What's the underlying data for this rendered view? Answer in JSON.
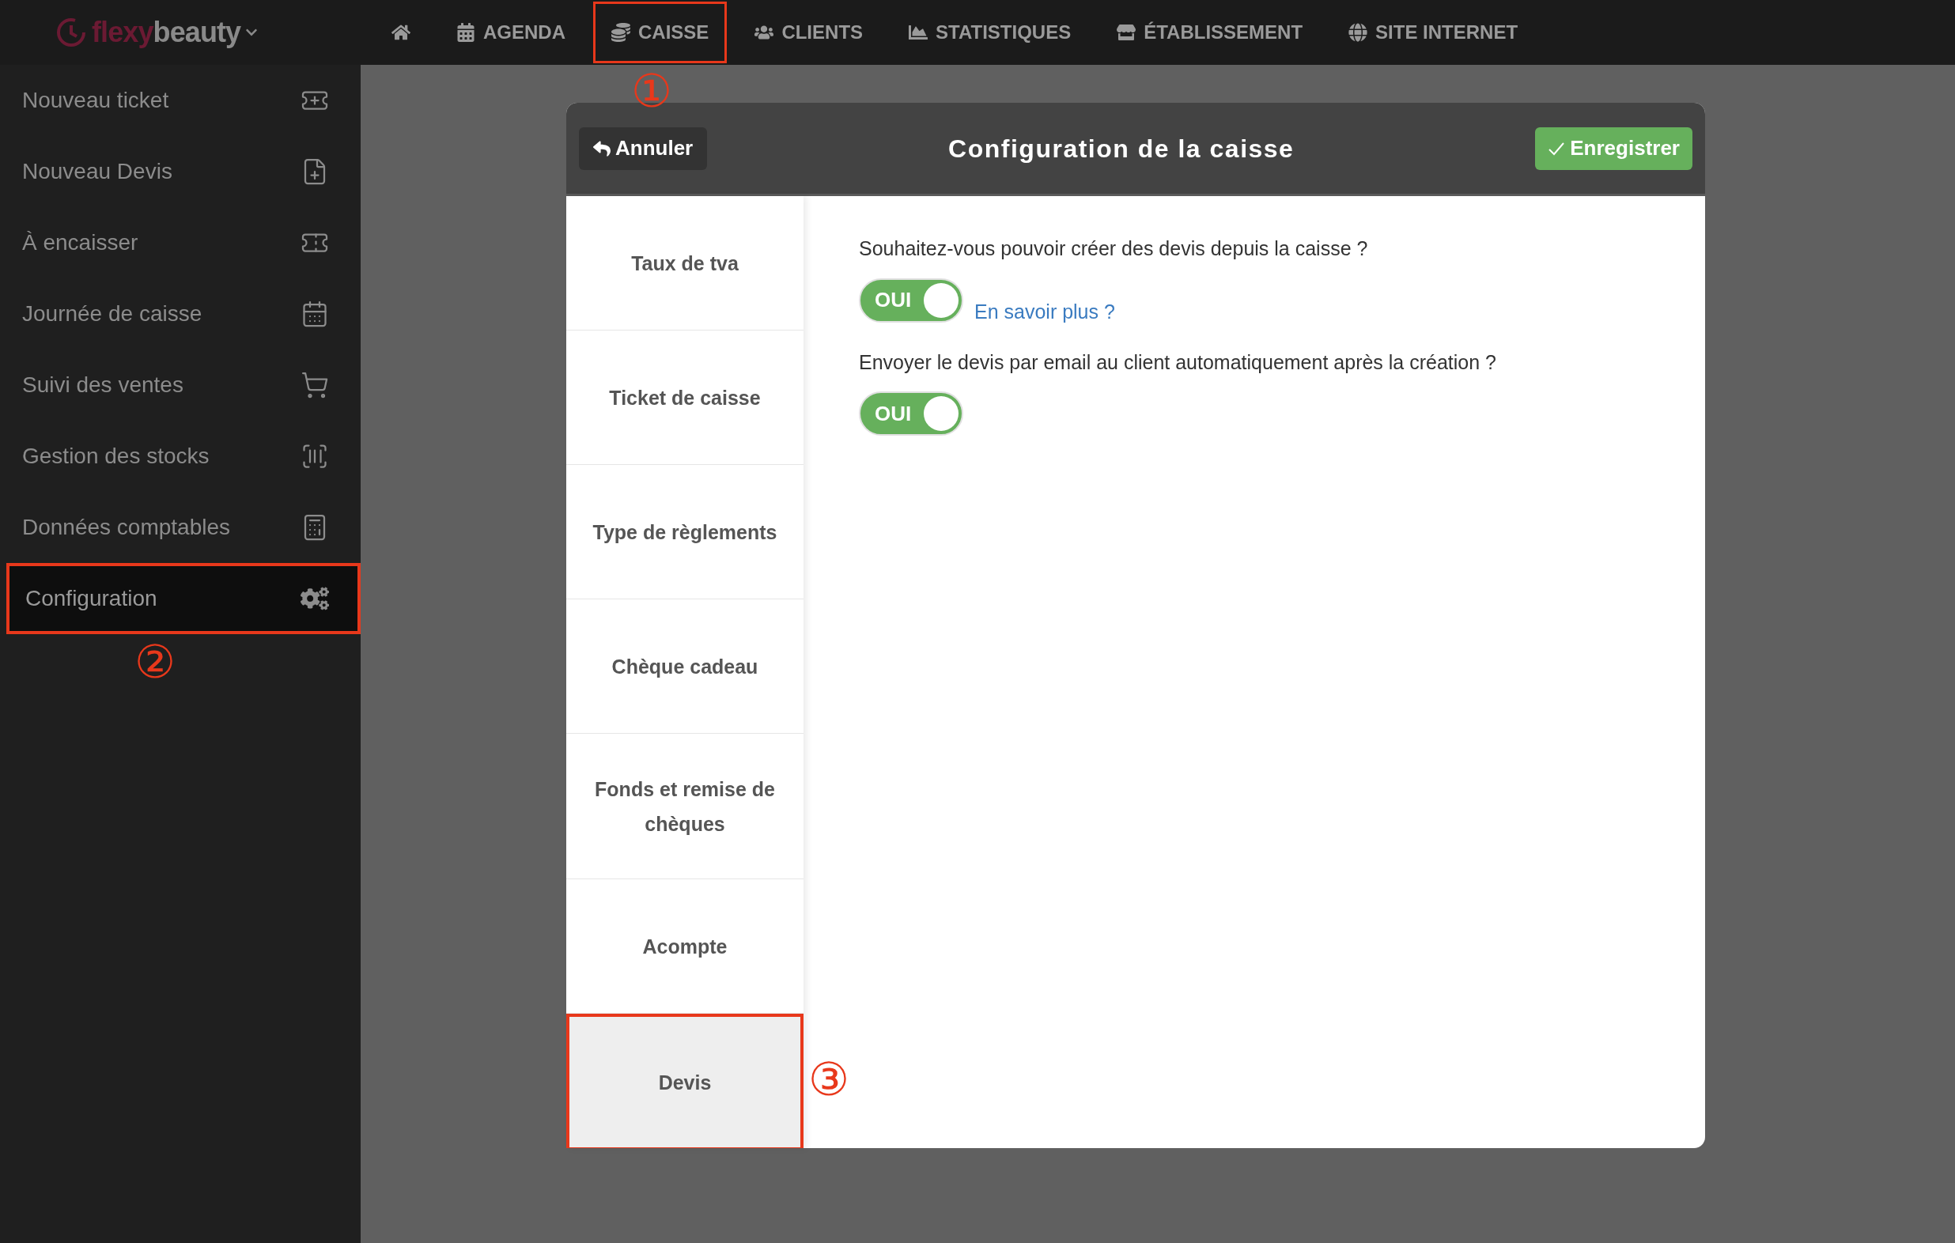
{
  "logo": {
    "first": "flexy",
    "second": "beauty"
  },
  "nav": [
    {
      "highlighted": false
    },
    {
      "label": "AGENDA",
      "highlighted": false
    },
    {
      "label": "CAISSE",
      "highlighted": true,
      "callout": "①"
    },
    {
      "label": "CLIENTS",
      "highlighted": false
    },
    {
      "label": "STATISTIQUES",
      "highlighted": false
    },
    {
      "label": "ÉTABLISSEMENT",
      "highlighted": false
    },
    {
      "label": "SITE INTERNET",
      "highlighted": false
    }
  ],
  "sidebar": {
    "items": [
      {
        "label": "Nouveau ticket",
        "selected": false,
        "highlighted": false
      },
      {
        "label": "Nouveau Devis",
        "selected": false,
        "highlighted": false
      },
      {
        "label": "À encaisser",
        "selected": false,
        "highlighted": false
      },
      {
        "label": "Journée de caisse",
        "selected": false,
        "highlighted": false
      },
      {
        "label": "Suivi des ventes",
        "selected": false,
        "highlighted": false
      },
      {
        "label": "Gestion des stocks",
        "selected": false,
        "highlighted": false
      },
      {
        "label": "Données comptables",
        "selected": false,
        "highlighted": false
      },
      {
        "label": "Configuration",
        "selected": true,
        "highlighted": true,
        "callout": "②"
      }
    ]
  },
  "dialog": {
    "cancel": "Annuler",
    "title": "Configuration de la caisse",
    "save": "Enregistrer",
    "tabs": [
      {
        "label": "Taux de tva",
        "selected": false,
        "highlighted": false
      },
      {
        "label": "Ticket de caisse",
        "selected": false,
        "highlighted": false
      },
      {
        "label": "Type de règlements",
        "selected": false,
        "highlighted": false
      },
      {
        "label": "Chèque cadeau",
        "selected": false,
        "highlighted": false
      },
      {
        "label": "Fonds et remise de chèques",
        "selected": false,
        "highlighted": false
      },
      {
        "label": "Acompte",
        "selected": false,
        "highlighted": false
      },
      {
        "label": "Devis",
        "selected": true,
        "highlighted": true,
        "callout": "③"
      }
    ],
    "settings": [
      {
        "question": "Souhaitez-vous pouvoir créer des devis depuis la caisse ?",
        "toggle": {
          "on": true,
          "label": "OUI"
        },
        "link": "En savoir plus ?"
      },
      {
        "question": "Envoyer le devis par email au client automatiquement après la création ?",
        "toggle": {
          "on": true,
          "label": "OUI"
        }
      }
    ]
  }
}
